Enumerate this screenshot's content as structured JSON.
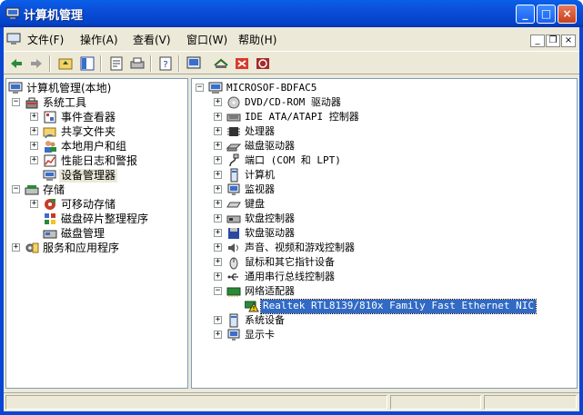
{
  "window": {
    "title": "计算机管理"
  },
  "menu": {
    "file": "文件(F)",
    "action": "操作(A)",
    "view": "查看(V)",
    "window": "窗口(W)",
    "help": "帮助(H)"
  },
  "left_tree": {
    "root": "计算机管理(本地)",
    "system_tools": "系统工具",
    "event_viewer": "事件查看器",
    "shared_folders": "共享文件夹",
    "local_users": "本地用户和组",
    "perf_logs": "性能日志和警报",
    "device_manager": "设备管理器",
    "storage": "存储",
    "removable": "可移动存储",
    "defrag": "磁盘碎片整理程序",
    "disk_mgmt": "磁盘管理",
    "services": "服务和应用程序"
  },
  "right_tree": {
    "root": "MICROSOF-BDFAC5",
    "dvd": "DVD/CD-ROM 驱动器",
    "ide": "IDE ATA/ATAPI 控制器",
    "cpu": "处理器",
    "disk": "磁盘驱动器",
    "ports": "端口 (COM 和 LPT)",
    "computer": "计算机",
    "monitor": "监视器",
    "keyboard": "键盘",
    "floppy_ctrl": "软盘控制器",
    "floppy_drv": "软盘驱动器",
    "sound": "声音、视频和游戏控制器",
    "mouse": "鼠标和其它指针设备",
    "usb": "通用串行总线控制器",
    "network": "网络适配器",
    "nic": "Realtek RTL8139/810x Family Fast Ethernet NIC",
    "system": "系统设备",
    "display": "显示卡"
  },
  "colors": {
    "titlebar": "#0a4fd6",
    "selection": "#316ac5",
    "warning": "#ffd800"
  }
}
